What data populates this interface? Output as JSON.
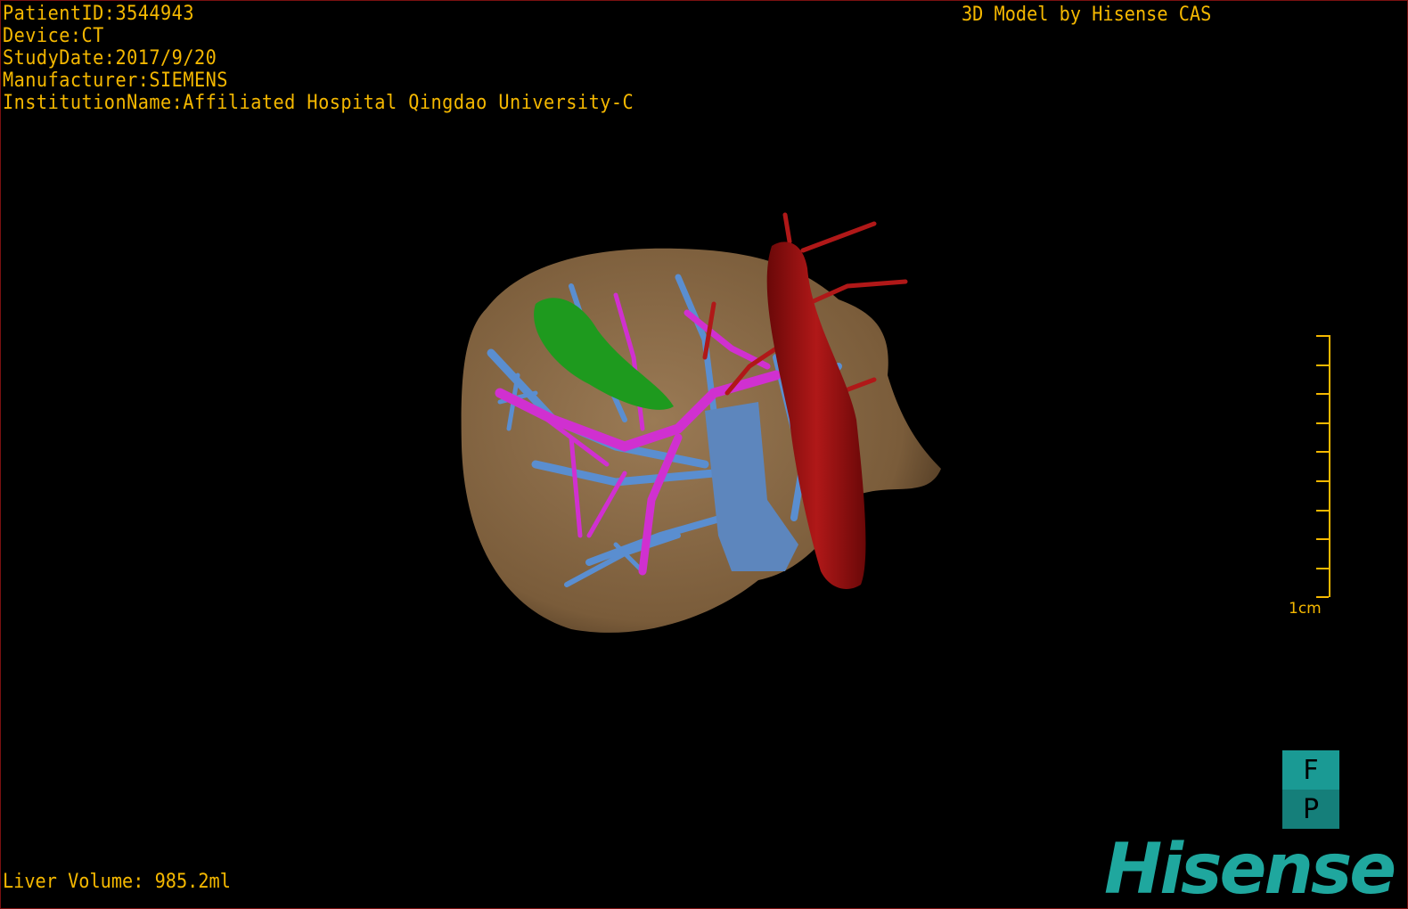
{
  "overlay": {
    "patient_id": "PatientID:3544943",
    "device": "Device:CT",
    "study_date": "StudyDate:2017/9/20",
    "manufacturer": "Manufacturer:SIEMENS",
    "institution": "InstitutionName:Affiliated Hospital Qingdao University-C",
    "credit": "3D Model by Hisense CAS",
    "liver_volume": "Liver Volume: 985.2ml"
  },
  "scale_bar": {
    "label": "1cm"
  },
  "orientation": {
    "top": "F",
    "bottom": "P"
  },
  "logo": "Hisense",
  "colors": {
    "text": "#f5b800",
    "liver": "#8a6a45",
    "gallbladder": "#1e9a1e",
    "portal_vein": "#d030d0",
    "hepatic_vein": "#5a8ed0",
    "artery": "#a01010",
    "brand": "#1fa79e"
  }
}
